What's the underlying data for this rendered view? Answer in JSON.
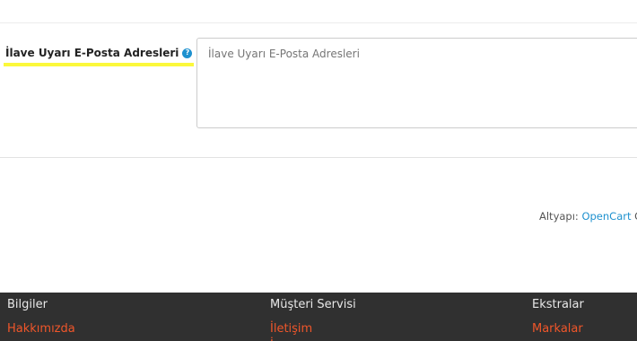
{
  "form": {
    "field_label": "İlave Uyarı E-Posta Adresleri",
    "help_icon": "question-circle-icon",
    "textarea_placeholder": "İlave Uyarı E-Posta Adresleri",
    "textarea_value": ""
  },
  "footer_credit": {
    "prefix": "Altyapı: ",
    "link_text": "OpenCart",
    "trailing": " C"
  },
  "footer": {
    "columns": [
      {
        "heading": "Bilgiler",
        "links": [
          "Hakkımızda"
        ]
      },
      {
        "heading": "Müşteri Servisi",
        "links": [
          "İletişim",
          "İ"
        ]
      },
      {
        "heading": "Ekstralar",
        "links": [
          "Markalar"
        ]
      }
    ]
  },
  "colors": {
    "highlight": "#fbf83b",
    "link_blue": "#1e91cf",
    "footer_bg": "#303030",
    "footer_link": "#f0562a"
  }
}
